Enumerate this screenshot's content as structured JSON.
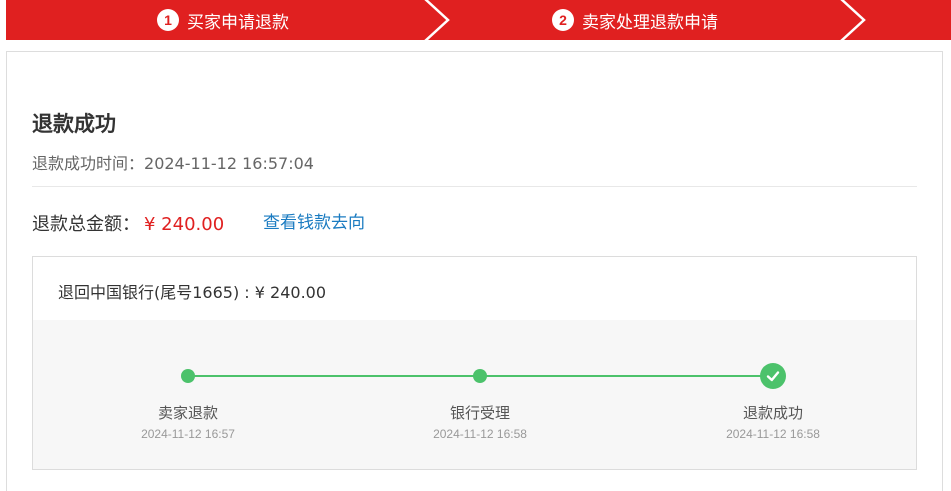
{
  "steps": [
    {
      "number": "1",
      "label": "买家申请退款"
    },
    {
      "number": "2",
      "label": "卖家处理退款申请"
    }
  ],
  "result": {
    "title": "退款成功",
    "time_label": "退款成功时间：",
    "time_value": "2024-11-12 16:57:04",
    "total_label": "退款总金额：",
    "total_value": "¥ 240.00",
    "view_link": "查看钱款去向"
  },
  "detail": {
    "destination": "退回中国银行(尾号1665) : ¥ 240.00",
    "stages": [
      {
        "name": "卖家退款",
        "time": "2024-11-12 16:57"
      },
      {
        "name": "银行受理",
        "time": "2024-11-12 16:58"
      },
      {
        "name": "退款成功",
        "time": "2024-11-12 16:58"
      }
    ]
  },
  "colors": {
    "brand_red": "#e02020",
    "success_green": "#4cc26b",
    "link_blue": "#1a7bc1"
  },
  "icons": [
    "chevron-right-icon",
    "checkmark-icon"
  ]
}
